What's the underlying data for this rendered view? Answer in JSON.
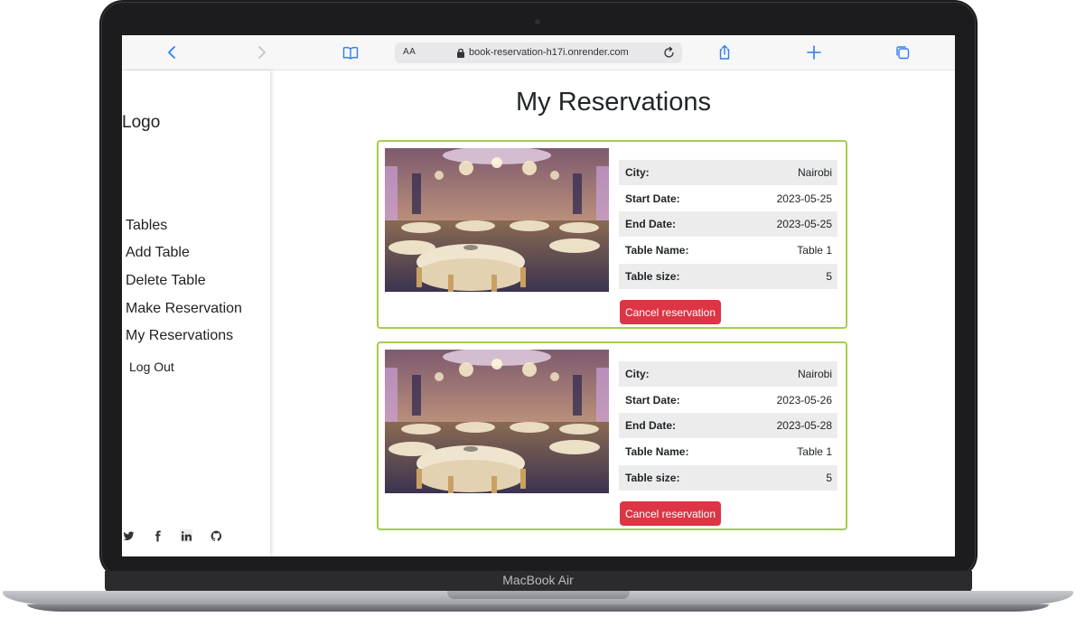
{
  "device": {
    "brand_label": "MacBook Air"
  },
  "browser": {
    "url_aa": "AA",
    "url": "book-reservation-h17i.onrender.com"
  },
  "sidebar": {
    "logo": "Logo",
    "items": [
      {
        "label": "Tables"
      },
      {
        "label": "Add Table"
      },
      {
        "label": "Delete Table"
      },
      {
        "label": "Make Reservation"
      },
      {
        "label": "My Reservations"
      }
    ],
    "logout": "Log Out",
    "social": [
      "twitter-icon",
      "facebook-icon",
      "linkedin-icon",
      "github-icon"
    ]
  },
  "main": {
    "title": "My Reservations",
    "labels": {
      "city": "City:",
      "start_date": "Start Date:",
      "end_date": "End Date:",
      "table_name": "Table Name:",
      "table_size": "Table size:"
    },
    "cancel_label": "Cancel reservation",
    "reservations": [
      {
        "city": "Nairobi",
        "start_date": "2023-05-25",
        "end_date": "2023-05-25",
        "table_name": "Table 1",
        "table_size": "5"
      },
      {
        "city": "Nairobi",
        "start_date": "2023-05-26",
        "end_date": "2023-05-28",
        "table_name": "Table 1",
        "table_size": "5"
      }
    ]
  },
  "colors": {
    "card_border": "#a5cd4e",
    "cancel_button": "#dc3545",
    "browser_accent": "#2f7cf6",
    "row_shade": "#ececec"
  }
}
